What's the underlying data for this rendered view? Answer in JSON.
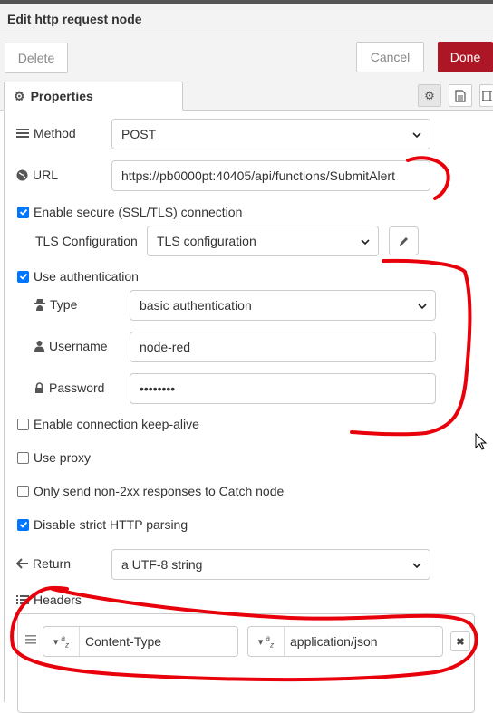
{
  "title": "Edit http request node",
  "buttons": {
    "delete": "Delete",
    "cancel": "Cancel",
    "done": "Done"
  },
  "tabs": {
    "properties": "Properties"
  },
  "method": {
    "label": "Method",
    "value": "POST"
  },
  "url": {
    "label": "URL",
    "value": "https://pb0000pt:40405/api/functions/SubmitAlert"
  },
  "tls_enable": {
    "label": "Enable secure (SSL/TLS) connection",
    "checked": true
  },
  "tls_config": {
    "label": "TLS Configuration",
    "value": "TLS configuration"
  },
  "auth": {
    "label": "Use authentication",
    "checked": true,
    "type_label": "Type",
    "type_value": "basic authentication",
    "username_label": "Username",
    "username_value": "node-red",
    "password_label": "Password",
    "password_value": "••••••••"
  },
  "keepalive": {
    "label": "Enable connection keep-alive",
    "checked": false
  },
  "proxy": {
    "label": "Use proxy",
    "checked": false
  },
  "non2xx": {
    "label": "Only send non-2xx responses to Catch node",
    "checked": false
  },
  "strict": {
    "label": "Disable strict HTTP parsing",
    "checked": true
  },
  "return": {
    "label": "Return",
    "value": "a UTF-8 string"
  },
  "headers": {
    "label": "Headers",
    "rows": [
      {
        "name": "Content-Type",
        "value": "application/json"
      }
    ]
  },
  "colors": {
    "accent": "#ad1625",
    "checkbox": "#0075ff",
    "annotation": "#e8000a"
  }
}
